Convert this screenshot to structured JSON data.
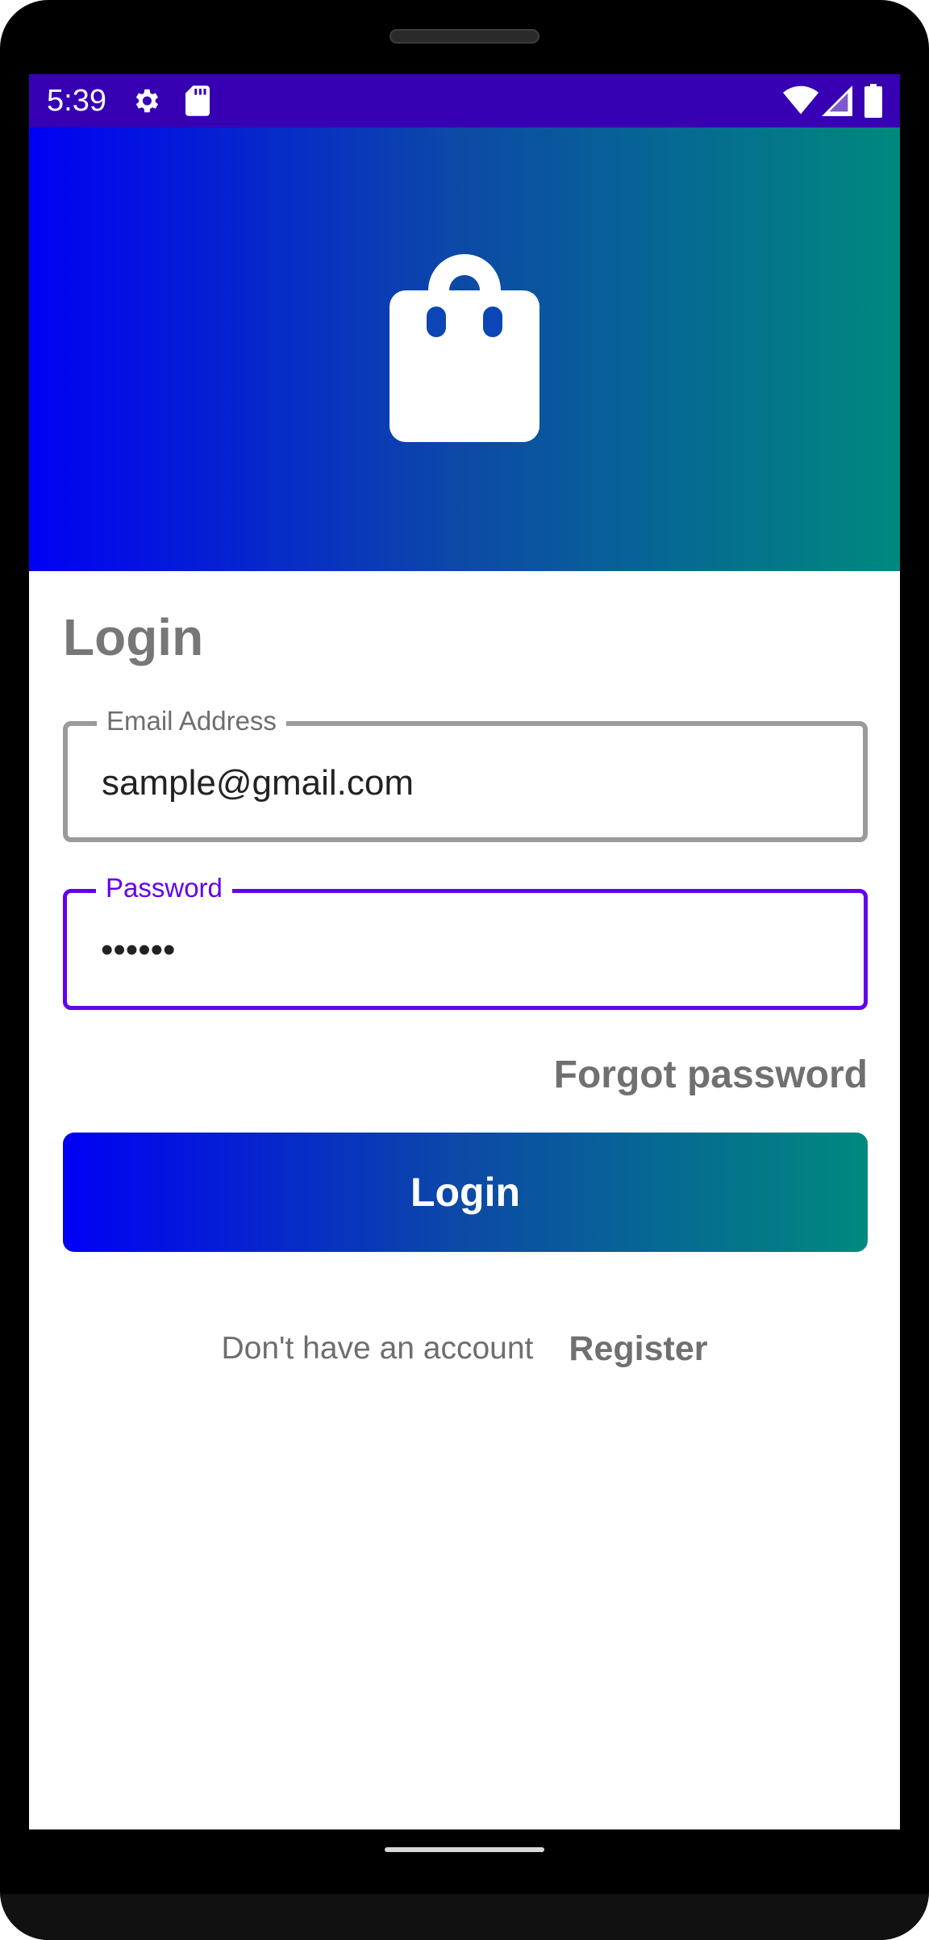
{
  "status_bar": {
    "time": "5:39",
    "icons": [
      "gear-icon",
      "sd-card-icon",
      "wifi-icon",
      "signal-icon",
      "battery-icon"
    ],
    "color": "#3700b3"
  },
  "hero": {
    "icon": "shopping-bag-icon",
    "gradient": [
      "#0000f5",
      "#00897e"
    ]
  },
  "form": {
    "title": "Login",
    "email": {
      "label": "Email Address",
      "value": "sample@gmail.com"
    },
    "password": {
      "label": "Password",
      "value": "••••••",
      "focused": true
    },
    "forgot_label": "Forgot password",
    "login_label": "Login",
    "no_account_text": "Don't have an account",
    "register_label": "Register"
  },
  "colors": {
    "accent": "#6200ee",
    "muted_text": "#707070"
  }
}
